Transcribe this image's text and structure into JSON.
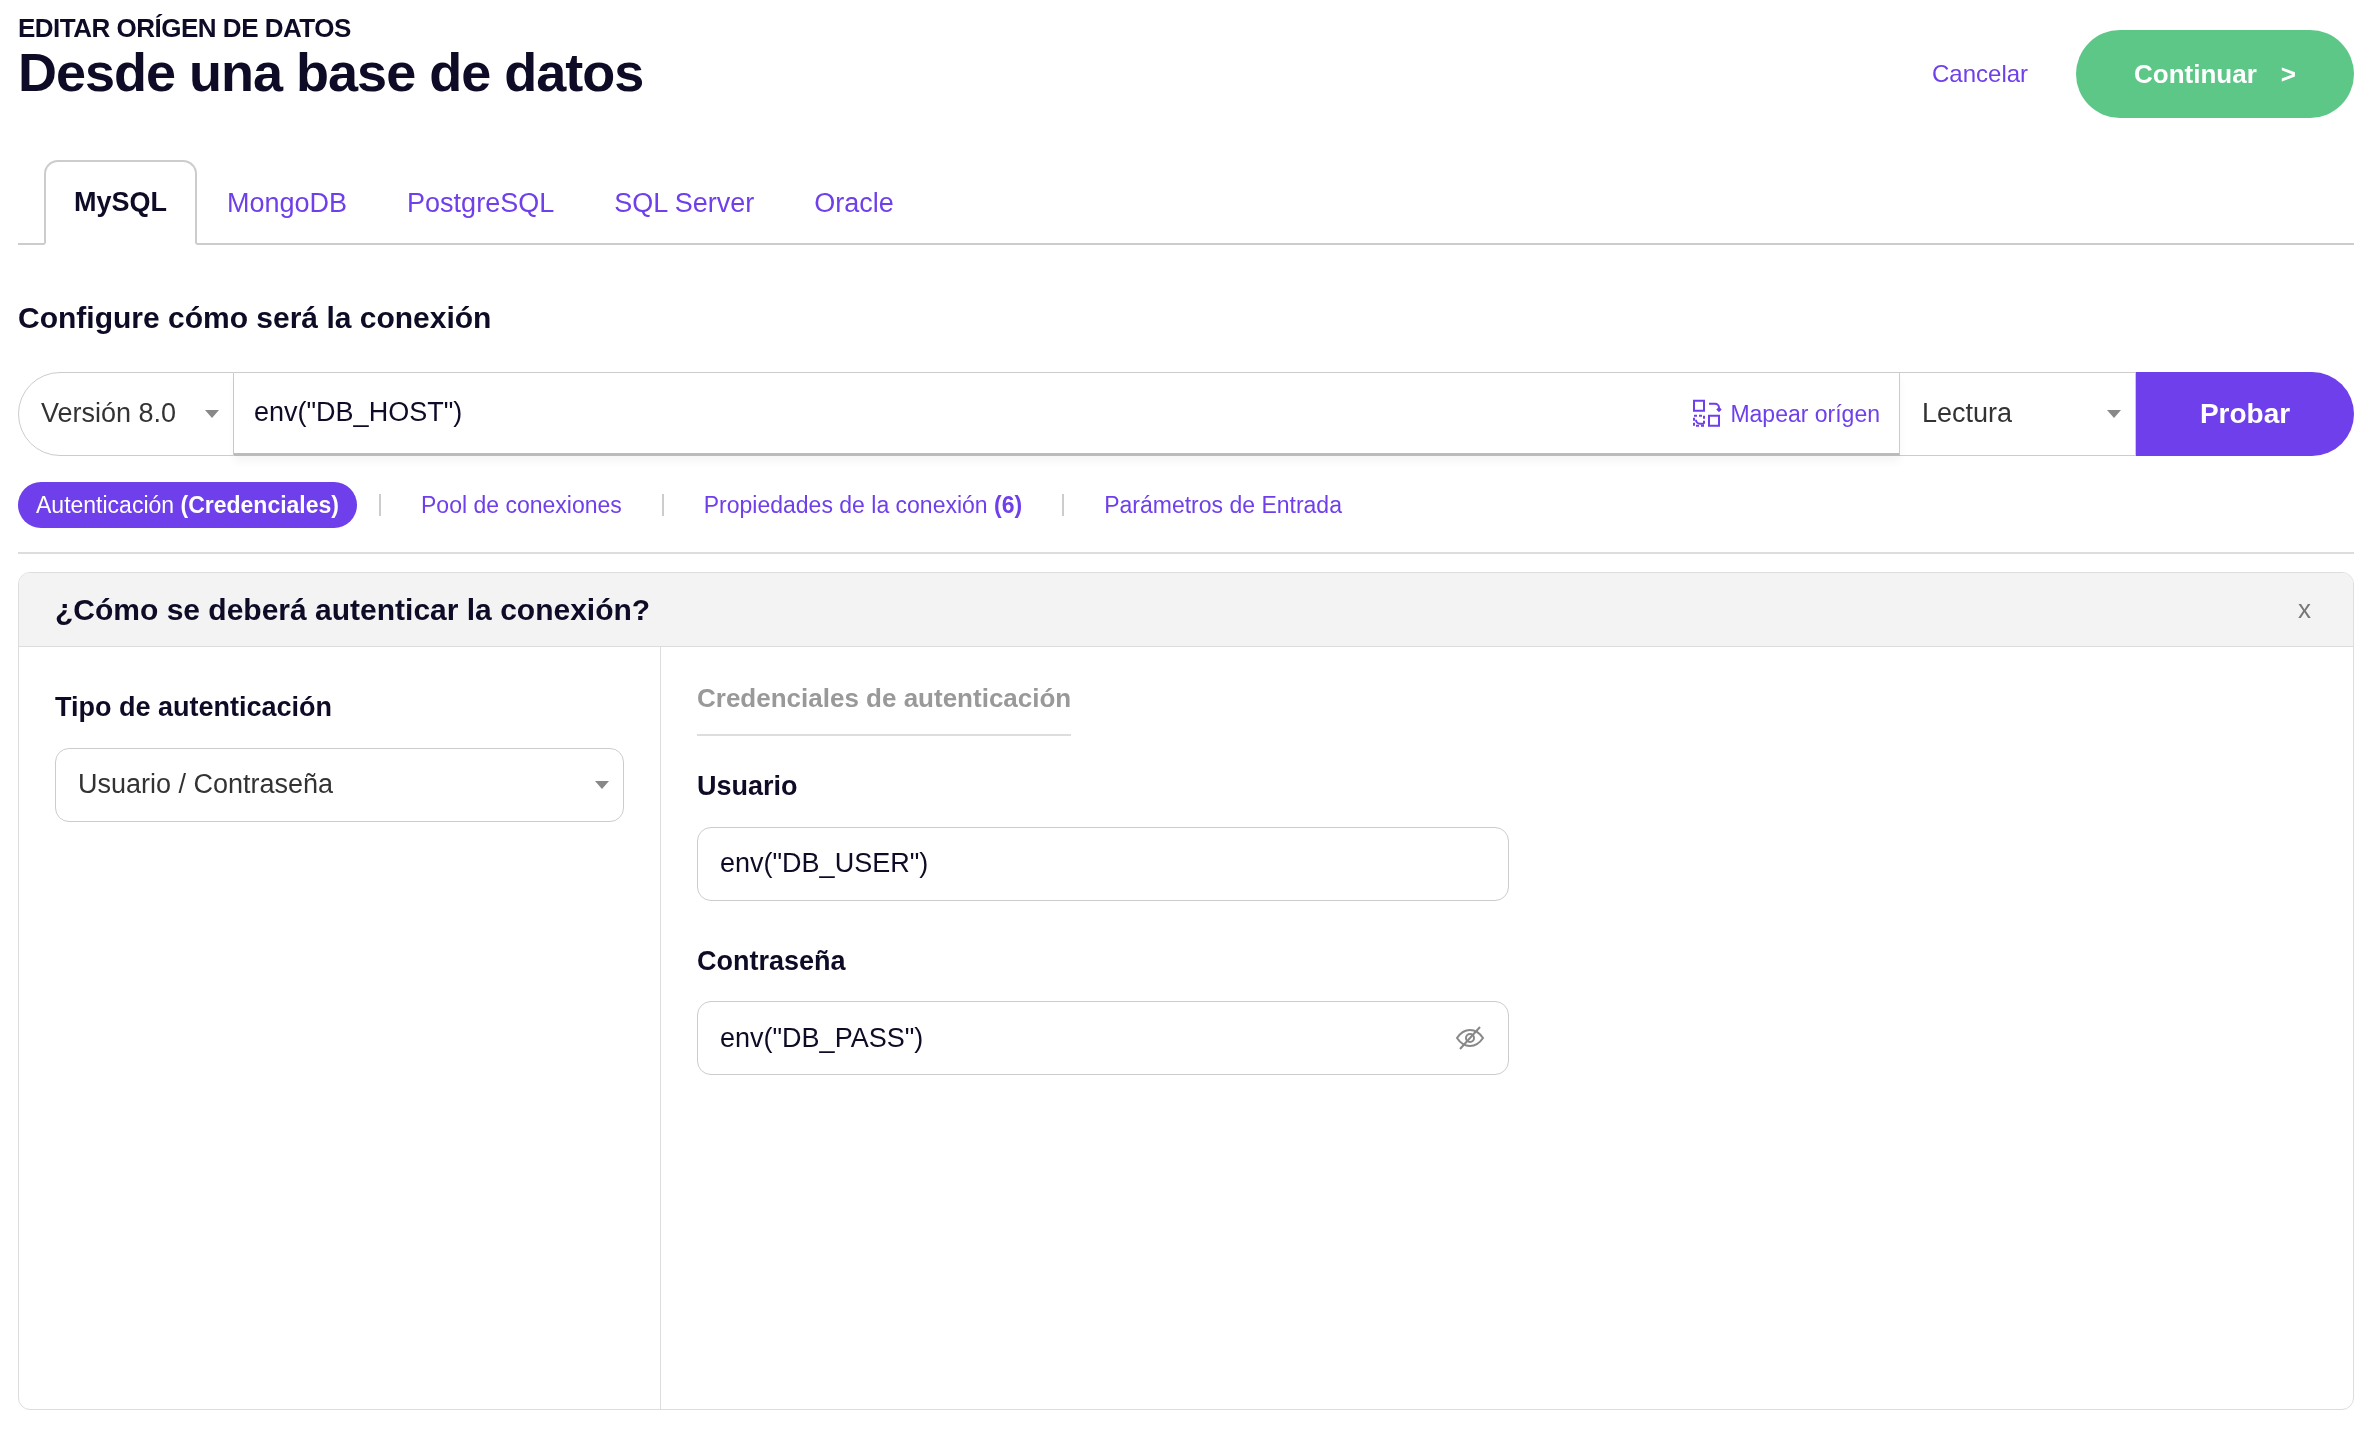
{
  "header": {
    "overline": "EDITAR ORÍGEN DE DATOS",
    "title": "Desde una base de datos",
    "cancel": "Cancelar",
    "continue": "Continuar",
    "continue_arrow": ">"
  },
  "tabs": [
    {
      "label": "MySQL",
      "selected": true
    },
    {
      "label": "MongoDB",
      "selected": false
    },
    {
      "label": "PostgreSQL",
      "selected": false
    },
    {
      "label": "SQL Server",
      "selected": false
    },
    {
      "label": "Oracle",
      "selected": false
    }
  ],
  "section_title": "Configure cómo será la conexión",
  "connection": {
    "version": "Versión 8.0",
    "host": "env(\"DB_HOST\")",
    "map_link": "Mapear orígen",
    "mode": "Lectura",
    "test_button": "Probar"
  },
  "subtabs": [
    {
      "label": "Autenticación **(Credenciales)**",
      "selected": true
    },
    {
      "label": "Pool de conexiones",
      "selected": false
    },
    {
      "label": "Propiedades de la conexión **(6)**",
      "selected": false
    },
    {
      "label": "Parámetros de Entrada",
      "selected": false
    }
  ],
  "auth_panel": {
    "title": "¿Cómo se deberá autenticar la conexión?",
    "close": "x",
    "type_label": "Tipo de autenticación",
    "type_value": "Usuario / Contraseña",
    "credentials_heading": "Credenciales de autenticación",
    "fields": [
      {
        "label": "Usuario",
        "value": "env(\"DB_USER\")",
        "kind": "text"
      },
      {
        "label": "Contraseña",
        "value": "env(\"DB_PASS\")",
        "kind": "password"
      }
    ]
  }
}
